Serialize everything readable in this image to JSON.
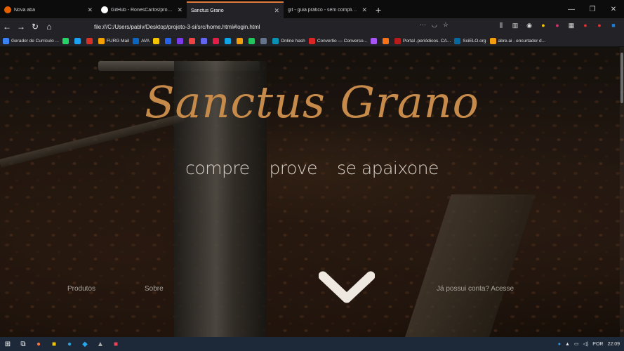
{
  "tabs": [
    {
      "title": "Nova aba",
      "color": "#e66000"
    },
    {
      "title": "GitHub - RonesCarlos/projeto",
      "color": "#ffffff"
    },
    {
      "title": "Sanctus Grano",
      "color": "#e07a3c"
    },
    {
      "title": "git - guia prático - sem complicaç",
      "color": "#e24329"
    }
  ],
  "address": {
    "url": "file:///C:/Users/pablv/Desktop/projeto-3-si/src/home.html#login.html"
  },
  "bookmarks": [
    {
      "label": "Gerador de Curriculo ...",
      "color": "#3b82f6"
    },
    {
      "label": "",
      "color": "#25d366"
    },
    {
      "label": "",
      "color": "#1da1f2"
    },
    {
      "label": "",
      "color": "#d93025"
    },
    {
      "label": "FURG Mail",
      "color": "#f4a100"
    },
    {
      "label": "AVA",
      "color": "#0a66c2"
    },
    {
      "label": "",
      "color": "#f5c400"
    },
    {
      "label": "",
      "color": "#2563eb"
    },
    {
      "label": "",
      "color": "#7c3aed"
    },
    {
      "label": "",
      "color": "#ef4444"
    },
    {
      "label": "",
      "color": "#6366f1"
    },
    {
      "label": "",
      "color": "#e11d48"
    },
    {
      "label": "",
      "color": "#0ea5e9"
    },
    {
      "label": "",
      "color": "#f59e0b"
    },
    {
      "label": "",
      "color": "#22c55e"
    },
    {
      "label": "",
      "color": "#64748b"
    },
    {
      "label": "Online hash",
      "color": "#0891b2"
    },
    {
      "label": "Convertio — Converso...",
      "color": "#dc2626"
    },
    {
      "label": "",
      "color": "#a855f7"
    },
    {
      "label": "",
      "color": "#f97316"
    },
    {
      "label": "Portal .periódicos. CA...",
      "color": "#b91c1c"
    },
    {
      "label": "SciELO.org",
      "color": "#0369a1"
    },
    {
      "label": "abre.ai - encurtador d...",
      "color": "#f59e0b"
    }
  ],
  "site": {
    "brand": "Sanctus Grano",
    "tagline": [
      "compre",
      "prove",
      "se apaixone"
    ],
    "nav": {
      "produtos": "Produtos",
      "sobre": "Sobre",
      "login": "Já possui conta? Acesse"
    }
  },
  "taskbar": {
    "lang": "POR",
    "time": "22:09"
  }
}
